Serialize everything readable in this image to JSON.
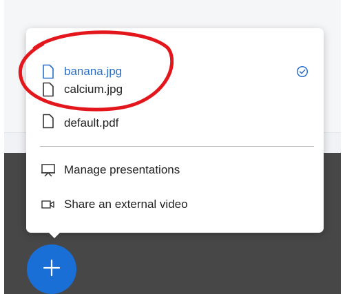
{
  "menu": {
    "presentations": [
      {
        "label": "banana.jpg",
        "icon": "file-icon",
        "selected": true
      },
      {
        "label": "calcium.jpg",
        "icon": "file-icon",
        "selected": false
      },
      {
        "label": "default.pdf",
        "icon": "file-icon",
        "selected": false
      }
    ],
    "manage_label": "Manage presentations",
    "share_video_label": "Share an external video"
  },
  "fab": {
    "icon": "plus-icon",
    "label": "+"
  },
  "colors": {
    "accent": "#1a6fd6",
    "selected_text": "#2a6fc9",
    "annotation": "#e3161c",
    "dark_background": "#474747"
  }
}
